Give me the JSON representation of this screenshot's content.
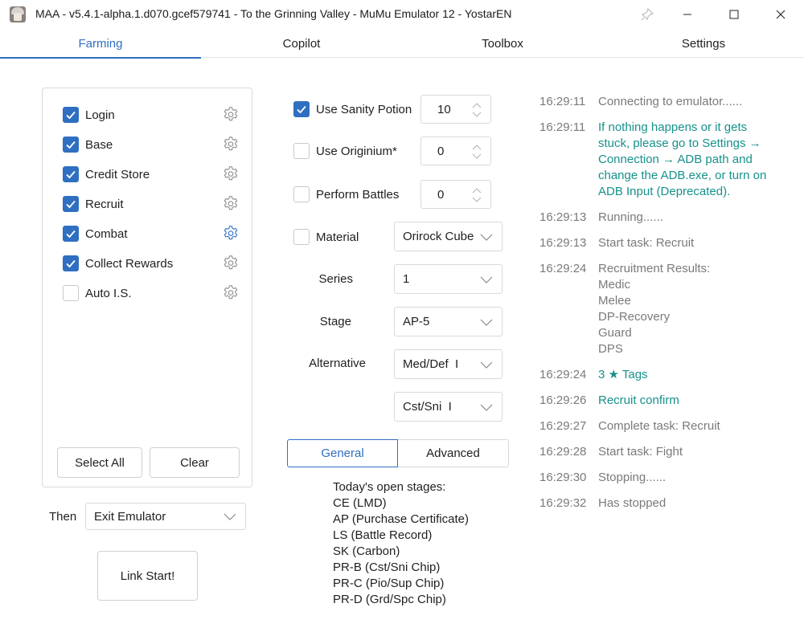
{
  "window": {
    "title": "MAA - v5.4.1-alpha.1.d070.gcef579741 - To the Grinning Valley - MuMu Emulator 12 - YostarEN"
  },
  "tabs": [
    "Farming",
    "Copilot",
    "Toolbox",
    "Settings"
  ],
  "active_tab": "Farming",
  "tasks": [
    {
      "label": "Login",
      "checked": true
    },
    {
      "label": "Base",
      "checked": true
    },
    {
      "label": "Credit Store",
      "checked": true
    },
    {
      "label": "Recruit",
      "checked": true
    },
    {
      "label": "Combat",
      "checked": true
    },
    {
      "label": "Collect Rewards",
      "checked": true
    },
    {
      "label": "Auto I.S.",
      "checked": false
    }
  ],
  "task_buttons": {
    "select_all": "Select All",
    "clear": "Clear"
  },
  "then": {
    "label": "Then",
    "value": "Exit Emulator"
  },
  "link_start": "Link Start!",
  "options": {
    "sanity": {
      "label": "Use Sanity Potion",
      "checked": true,
      "value": "10"
    },
    "originium": {
      "label": "Use Originium*",
      "checked": false,
      "value": "0"
    },
    "battles": {
      "label": "Perform Battles",
      "checked": false,
      "value": "0"
    },
    "material": {
      "label": "Material",
      "checked": false,
      "value": "Orirock Cube"
    }
  },
  "fields": {
    "series": {
      "label": "Series",
      "value": "1"
    },
    "stage": {
      "label": "Stage",
      "value": "AP-5"
    },
    "alternative": {
      "label": "Alternative",
      "value": "Med/Def  I"
    },
    "alternative2": {
      "value": "Cst/Sni  I"
    }
  },
  "segments": {
    "general": "General",
    "advanced": "Advanced"
  },
  "stages_info": {
    "heading": "Today's open stages:",
    "items": [
      "CE (LMD)",
      "AP (Purchase Certificate)",
      "LS (Battle Record)",
      "SK (Carbon)",
      "PR-B (Cst/Sni Chip)",
      "PR-C (Pio/Sup Chip)",
      "PR-D (Grd/Spc Chip)"
    ]
  },
  "log": [
    {
      "time": "16:29:11",
      "lines": [
        "Connecting to emulator......"
      ],
      "color": "gray"
    },
    {
      "time": "16:29:11",
      "lines": [
        "If nothing happens or it gets",
        "stuck, please go to Settings →",
        "Connection → ADB path and",
        "change the ADB.exe, or turn on",
        "ADB Input (Deprecated)."
      ],
      "color": "teal"
    },
    {
      "time": "16:29:13",
      "lines": [
        "Running......"
      ],
      "color": "gray"
    },
    {
      "time": "16:29:13",
      "lines": [
        "Start task: Recruit"
      ],
      "color": "gray"
    },
    {
      "time": "16:29:24",
      "lines": [
        "Recruitment Results:",
        "Medic",
        "Melee",
        "DP-Recovery",
        "Guard",
        "DPS"
      ],
      "color": "gray"
    },
    {
      "time": "16:29:24",
      "lines": [
        "3 ★ Tags"
      ],
      "color": "teal"
    },
    {
      "time": "16:29:26",
      "lines": [
        "Recruit confirm"
      ],
      "color": "teal"
    },
    {
      "time": "16:29:27",
      "lines": [
        "Complete task: Recruit"
      ],
      "color": "gray"
    },
    {
      "time": "16:29:28",
      "lines": [
        "Start task: Fight"
      ],
      "color": "gray"
    },
    {
      "time": "16:29:30",
      "lines": [
        "Stopping......"
      ],
      "color": "gray"
    },
    {
      "time": "16:29:32",
      "lines": [
        "Has stopped"
      ],
      "color": "gray"
    }
  ],
  "colors": {
    "accent": "#2f6fc1",
    "log_teal": "#16918a",
    "log_gray": "#7a7a7a"
  }
}
